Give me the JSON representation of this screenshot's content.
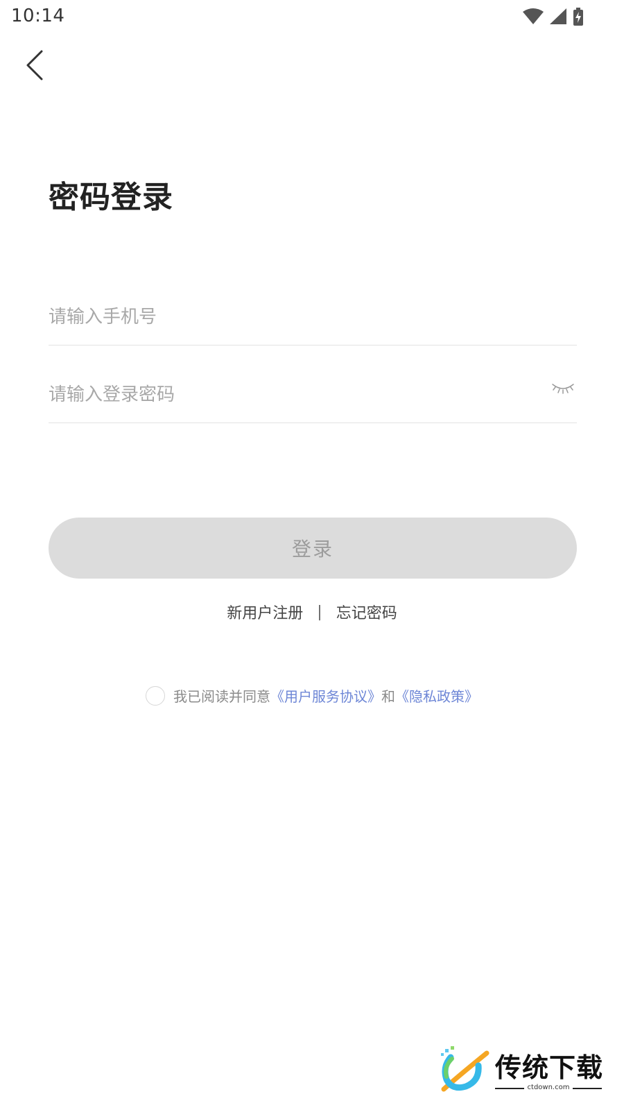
{
  "status_bar": {
    "time": "10:14",
    "icons": [
      "wifi-icon",
      "cellular-signal-icon",
      "battery-charging-icon"
    ]
  },
  "header": {
    "back_icon": "chevron-left-icon"
  },
  "page": {
    "title": "密码登录"
  },
  "form": {
    "phone": {
      "value": "",
      "placeholder": "请输入手机号"
    },
    "password": {
      "value": "",
      "placeholder": "请输入登录密码",
      "toggle_icon": "eye-closed-icon"
    },
    "login_label": "登录",
    "login_enabled": false
  },
  "links": {
    "register": "新用户注册",
    "separator": "|",
    "forgot": "忘记密码"
  },
  "agreement": {
    "checked": false,
    "prefix": "我已阅读并同意",
    "terms": "《用户服务协议》",
    "conjunction": "和",
    "privacy": "《隐私政策》"
  },
  "watermark": {
    "title": "传统下载",
    "subtitle": "ctdown.com"
  },
  "colors": {
    "background": "#ffffff",
    "title": "#222222",
    "placeholder": "#a8a8a8",
    "divider": "#e3e3e3",
    "button_disabled_bg": "#dcdcdc",
    "button_disabled_text": "#9c9c9c",
    "link_text": "#444444",
    "agreement_text": "#8a8a8a",
    "agreement_link": "#6d86d6"
  }
}
